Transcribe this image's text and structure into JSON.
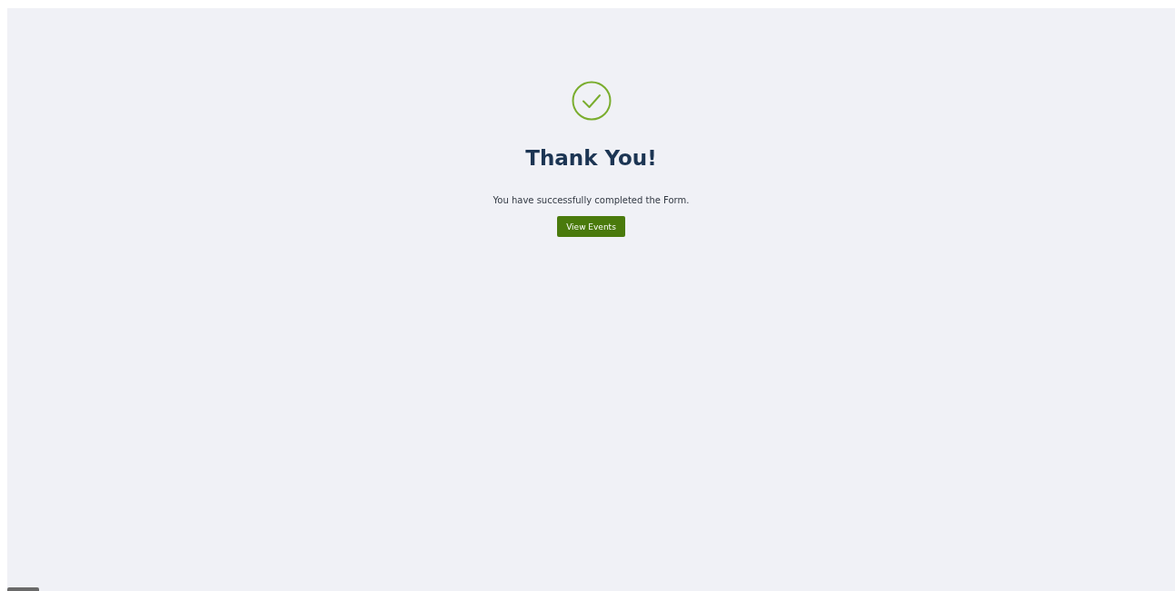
{
  "confirmation": {
    "title": "Thank You!",
    "message": "You have successfully completed the Form.",
    "button": "View Events"
  }
}
